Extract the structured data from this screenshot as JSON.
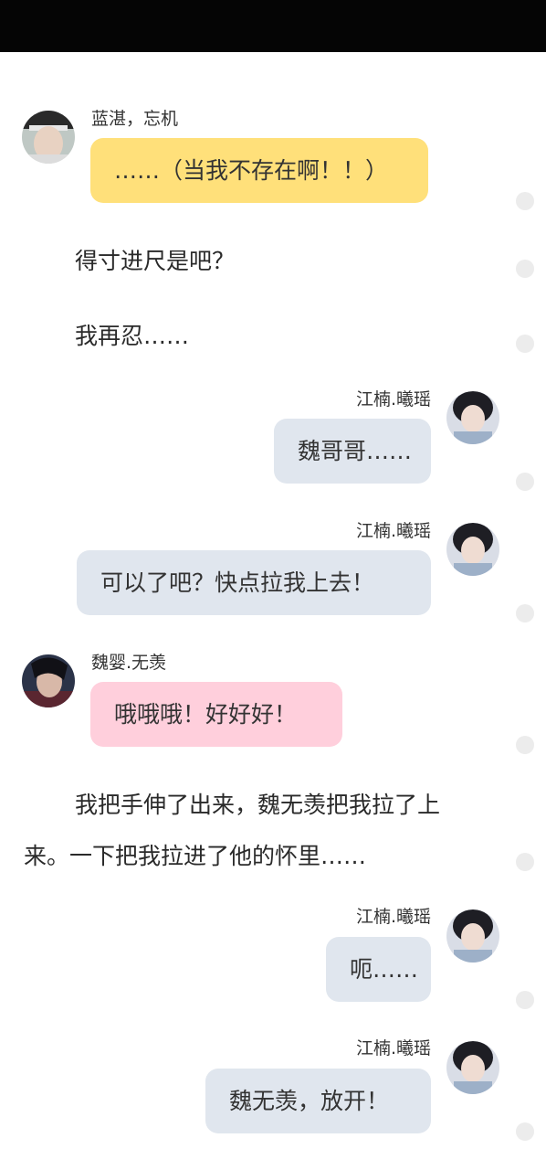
{
  "messages": [
    {
      "sender": "蓝湛，忘机",
      "text": "……（当我不存在啊！！）",
      "side": "left",
      "bubble_color": "#FFE07A",
      "avatar": "lan-zhan-avatar"
    },
    {
      "narration": "得寸进尺是吧？"
    },
    {
      "narration": "我再忍……"
    },
    {
      "sender": "江楠.曦瑶",
      "text": "魏哥哥……",
      "side": "right",
      "bubble_color": "#E0E6EE",
      "avatar": "jiang-nan-avatar"
    },
    {
      "sender": "江楠.曦瑶",
      "text": "可以了吧？快点拉我上去！",
      "side": "right",
      "bubble_color": "#E0E6EE",
      "avatar": "jiang-nan-avatar"
    },
    {
      "sender": "魏婴.无羡",
      "text": "哦哦哦！好好好！",
      "side": "left",
      "bubble_color": "#FFCFDC",
      "avatar": "wei-ying-avatar"
    },
    {
      "narration_line1": "我把手伸了出来，魏无羡把我拉了上",
      "narration_line2": "来。一下把我拉进了他的怀里……"
    },
    {
      "sender": "江楠.曦瑶",
      "text": "呃……",
      "side": "right",
      "bubble_color": "#E0E6EE",
      "avatar": "jiang-nan-avatar"
    },
    {
      "sender": "江楠.曦瑶",
      "text": "魏无羡，放开！",
      "side": "right",
      "bubble_color": "#E0E6EE",
      "avatar": "jiang-nan-avatar"
    }
  ],
  "colors": {
    "top_bar": "#050505",
    "dot": "#ECECEC"
  },
  "action_dots": 9
}
